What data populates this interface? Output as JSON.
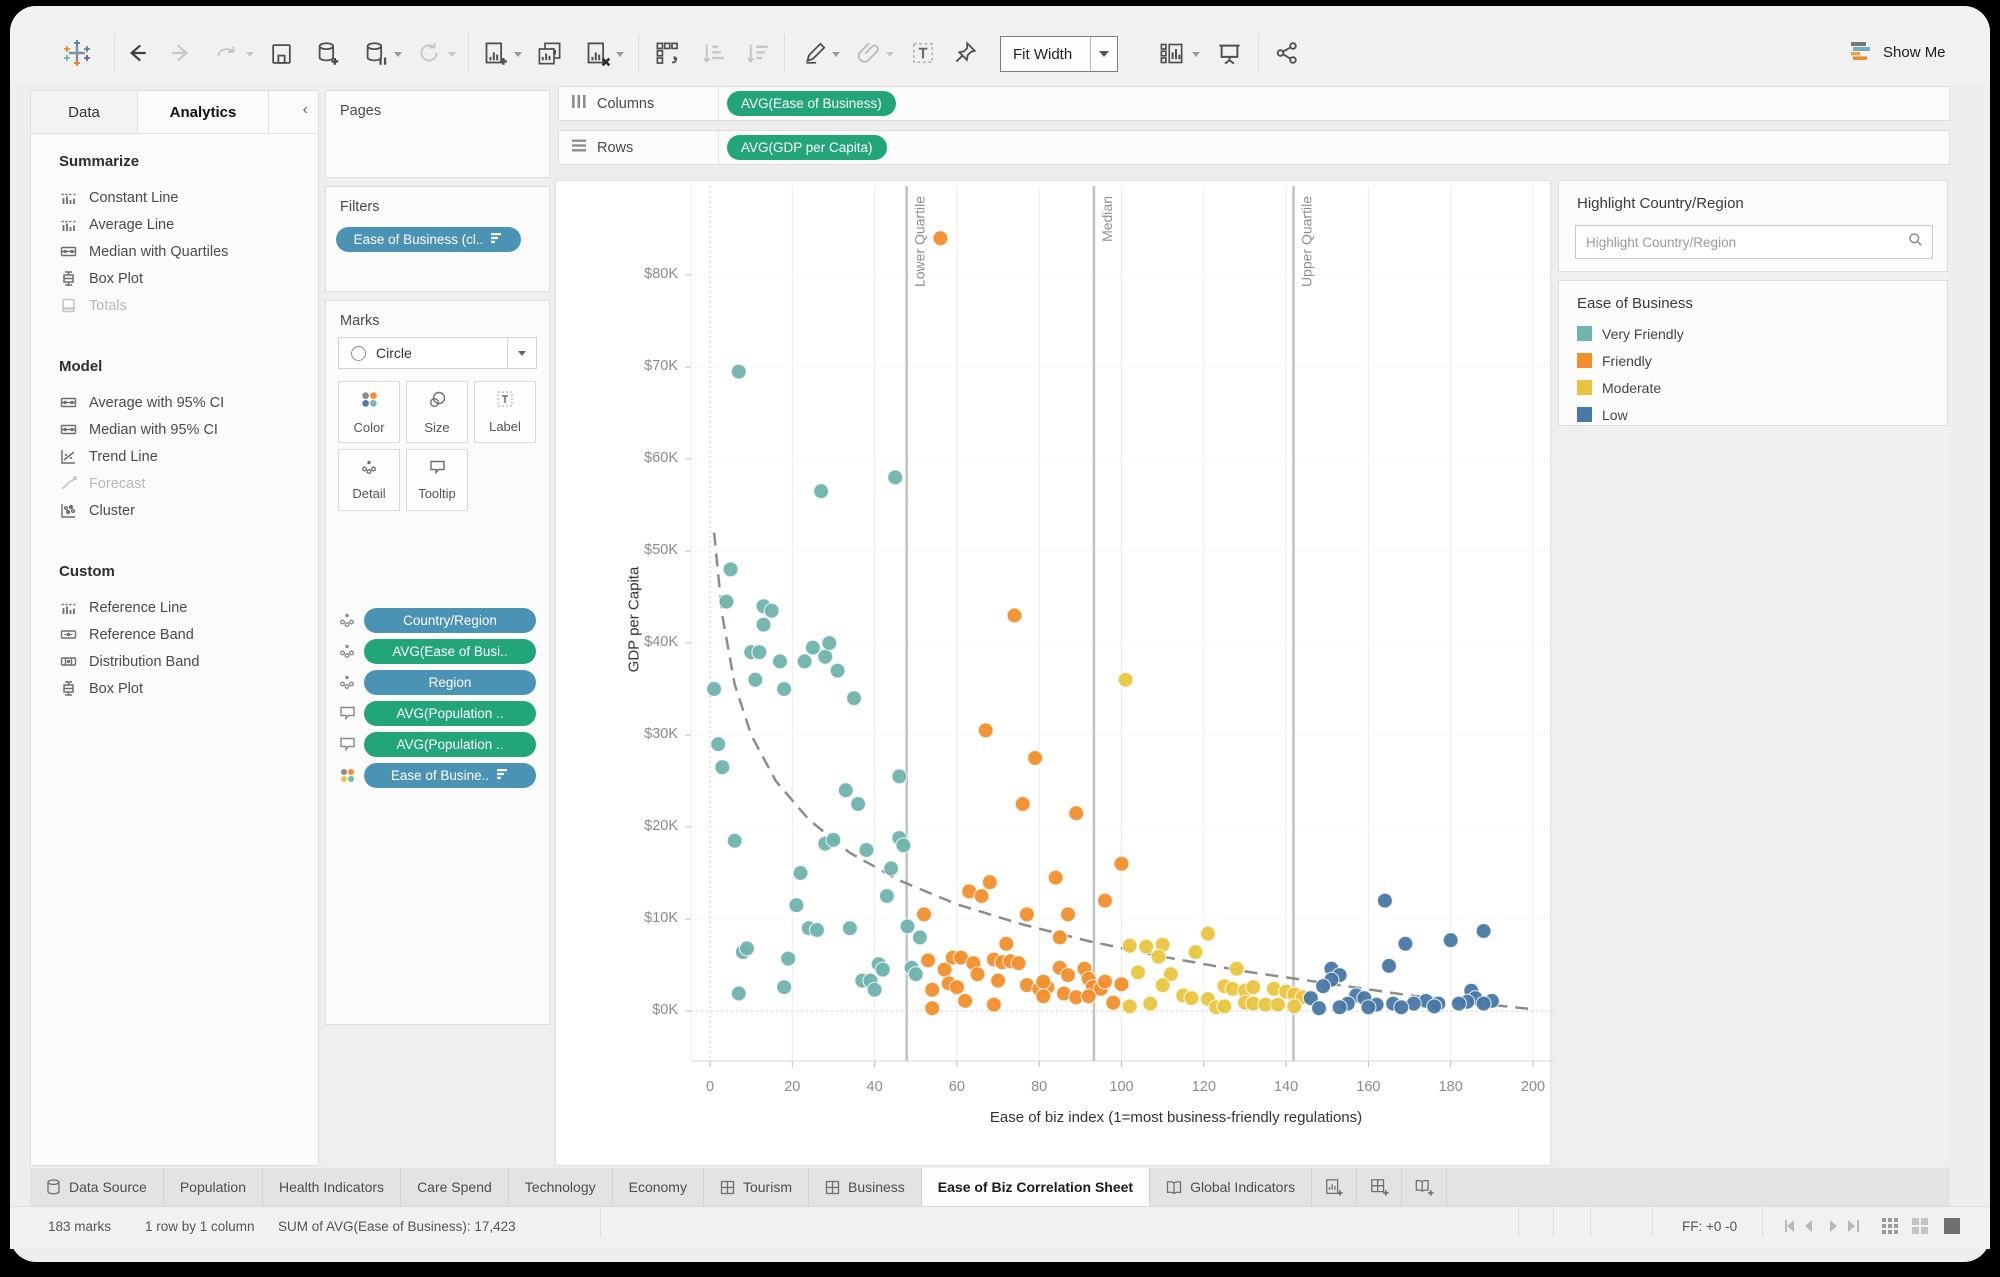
{
  "toolbar": {
    "fit_label": "Fit Width",
    "show_me_label": "Show Me",
    "icons": [
      "tableau-logo",
      "undo",
      "redo",
      "replay",
      "save",
      "add-data-source",
      "pause-auto-updates",
      "run-update",
      "new-worksheet",
      "duplicate-sheet",
      "clear-sheet",
      "swap-rows-columns",
      "sort-ascending",
      "sort-descending",
      "highlight",
      "group-members",
      "show-mark-labels",
      "fix-axes",
      "fit-selector",
      "show-me-toolbar",
      "presentation-mode",
      "share-workbook"
    ]
  },
  "left_panel": {
    "tabs": [
      {
        "label": "Data"
      },
      {
        "label": "Analytics",
        "active": true
      }
    ],
    "collapse_glyph": "‹",
    "sections": [
      {
        "title": "Summarize",
        "items": [
          {
            "label": "Constant Line",
            "icon": "ref-line"
          },
          {
            "label": "Average Line",
            "icon": "ref-line"
          },
          {
            "label": "Median with Quartiles",
            "icon": "band"
          },
          {
            "label": "Box Plot",
            "icon": "boxplot"
          },
          {
            "label": "Totals",
            "icon": "totals",
            "disabled": true
          }
        ]
      },
      {
        "title": "Model",
        "items": [
          {
            "label": "Average with 95% CI",
            "icon": "band"
          },
          {
            "label": "Median with 95% CI",
            "icon": "band"
          },
          {
            "label": "Trend Line",
            "icon": "trend"
          },
          {
            "label": "Forecast",
            "icon": "forecast",
            "disabled": true
          },
          {
            "label": "Cluster",
            "icon": "cluster"
          }
        ]
      },
      {
        "title": "Custom",
        "items": [
          {
            "label": "Reference Line",
            "icon": "ref-line"
          },
          {
            "label": "Reference Band",
            "icon": "ref-band"
          },
          {
            "label": "Distribution Band",
            "icon": "dist-band"
          },
          {
            "label": "Box Plot",
            "icon": "boxplot"
          }
        ]
      }
    ]
  },
  "cards": {
    "pages": {
      "title": "Pages"
    },
    "filters": {
      "title": "Filters",
      "pill": {
        "label": "Ease of Business (cl..",
        "color": "blue",
        "trailing_icon": "sorted-bars"
      }
    },
    "marks": {
      "title": "Marks",
      "mark_type": "Circle",
      "buttons": [
        {
          "label": "Color",
          "icon": "color-dots"
        },
        {
          "label": "Size",
          "icon": "size-circles"
        },
        {
          "label": "Label",
          "icon": "label-t"
        },
        {
          "label": "Detail",
          "icon": "detail-dots"
        },
        {
          "label": "Tooltip",
          "icon": "tooltip-bubble"
        }
      ],
      "pills": [
        {
          "lead": "detail-dots",
          "label": "Country/Region",
          "color": "blue"
        },
        {
          "lead": "detail-dots",
          "label": "AVG(Ease of Busi..",
          "color": "green"
        },
        {
          "lead": "detail-dots",
          "label": "Region",
          "color": "blue"
        },
        {
          "lead": "tooltip-bubble",
          "label": "AVG(Population ..",
          "color": "green"
        },
        {
          "lead": "tooltip-bubble",
          "label": "AVG(Population ..",
          "color": "green"
        },
        {
          "lead": "color-dots",
          "label": "Ease of Busine..",
          "color": "blue",
          "trailing_icon": "sorted-bars"
        }
      ]
    }
  },
  "shelves": {
    "columns": {
      "label": "Columns",
      "pill": "AVG(Ease of Business)"
    },
    "rows": {
      "label": "Rows",
      "pill": "AVG(GDP per Capita)"
    }
  },
  "chart_data": {
    "type": "scatter",
    "xlabel": "Ease of biz index (1=most business-friendly regulations)",
    "ylabel": "GDP per Capita",
    "xlim": [
      -5,
      203
    ],
    "ylim": [
      -5500,
      89500
    ],
    "x_ticks": [
      0,
      20,
      40,
      60,
      80,
      100,
      120,
      140,
      160,
      180,
      200
    ],
    "y_ticks": [
      {
        "v": 0,
        "label": "$0K"
      },
      {
        "v": 10000,
        "label": "$10K"
      },
      {
        "v": 20000,
        "label": "$20K"
      },
      {
        "v": 30000,
        "label": "$30K"
      },
      {
        "v": 40000,
        "label": "$40K"
      },
      {
        "v": 50000,
        "label": "$50K"
      },
      {
        "v": 60000,
        "label": "$60K"
      },
      {
        "v": 70000,
        "label": "$70K"
      },
      {
        "v": 80000,
        "label": "$80K"
      }
    ],
    "legend_title": "Ease of Business",
    "legend_position": "right",
    "grid": true,
    "reference_lines": [
      {
        "label": "Lower Quartile",
        "x": 47.8
      },
      {
        "label": "Median",
        "x": 93.3
      },
      {
        "label": "Upper Quartile",
        "x": 141.8
      }
    ],
    "trend_line": {
      "style": "dashed",
      "points": [
        [
          1,
          52000
        ],
        [
          3,
          43000
        ],
        [
          6,
          35500
        ],
        [
          10,
          30000
        ],
        [
          16,
          25000
        ],
        [
          24,
          20800
        ],
        [
          34,
          17200
        ],
        [
          46,
          14200
        ],
        [
          60,
          11600
        ],
        [
          76,
          9400
        ],
        [
          92,
          7600
        ],
        [
          110,
          5900
        ],
        [
          130,
          4300
        ],
        [
          150,
          3000
        ],
        [
          170,
          1700
        ],
        [
          185,
          900
        ],
        [
          200,
          200
        ]
      ]
    },
    "series": [
      {
        "name": "Very Friendly",
        "color": "#6fb3ae",
        "points": [
          [
            7,
            69500
          ],
          [
            27,
            56500
          ],
          [
            45,
            58000
          ],
          [
            5,
            48000
          ],
          [
            4,
            44500
          ],
          [
            13,
            44000
          ],
          [
            15,
            43500
          ],
          [
            13,
            42000
          ],
          [
            10,
            39000
          ],
          [
            12,
            39000
          ],
          [
            17,
            38000
          ],
          [
            23,
            38000
          ],
          [
            25,
            39500
          ],
          [
            28,
            38500
          ],
          [
            29,
            40000
          ],
          [
            31,
            37000
          ],
          [
            11,
            36000
          ],
          [
            18,
            35000
          ],
          [
            1,
            35000
          ],
          [
            35,
            34000
          ],
          [
            2,
            29000
          ],
          [
            3,
            26500
          ],
          [
            46,
            25500
          ],
          [
            33,
            24000
          ],
          [
            36,
            22500
          ],
          [
            6,
            18500
          ],
          [
            28,
            18200
          ],
          [
            30,
            18600
          ],
          [
            46,
            18800
          ],
          [
            47,
            18000
          ],
          [
            38,
            17500
          ],
          [
            44,
            15500
          ],
          [
            22,
            15000
          ],
          [
            43,
            12500
          ],
          [
            21,
            11500
          ],
          [
            24,
            9000
          ],
          [
            26,
            8800
          ],
          [
            34,
            9000
          ],
          [
            48,
            9200
          ],
          [
            51,
            8000
          ],
          [
            8,
            6400
          ],
          [
            9,
            6800
          ],
          [
            19,
            5700
          ],
          [
            41,
            5100
          ],
          [
            42,
            4500
          ],
          [
            37,
            3300
          ],
          [
            39,
            3300
          ],
          [
            40,
            2300
          ],
          [
            49,
            4700
          ],
          [
            50,
            4000
          ],
          [
            7,
            1900
          ],
          [
            18,
            2600
          ]
        ]
      },
      {
        "name": "Friendly",
        "color": "#f28e2b",
        "points": [
          [
            56,
            84000
          ],
          [
            74,
            43000
          ],
          [
            67,
            30500
          ],
          [
            79,
            27500
          ],
          [
            76,
            22500
          ],
          [
            89,
            21500
          ],
          [
            100,
            16000
          ],
          [
            96,
            12000
          ],
          [
            84,
            14500
          ],
          [
            68,
            14000
          ],
          [
            63,
            13000
          ],
          [
            66,
            12500
          ],
          [
            52,
            10500
          ],
          [
            77,
            10500
          ],
          [
            87,
            10500
          ],
          [
            85,
            8000
          ],
          [
            72,
            7300
          ],
          [
            53,
            5500
          ],
          [
            57,
            4500
          ],
          [
            59,
            5800
          ],
          [
            61,
            5800
          ],
          [
            64,
            5200
          ],
          [
            69,
            5600
          ],
          [
            71,
            5300
          ],
          [
            73,
            5400
          ],
          [
            75,
            5200
          ],
          [
            85,
            4700
          ],
          [
            87,
            3900
          ],
          [
            91,
            4600
          ],
          [
            92,
            3500
          ],
          [
            58,
            3000
          ],
          [
            60,
            2600
          ],
          [
            54,
            2300
          ],
          [
            65,
            4000
          ],
          [
            70,
            3300
          ],
          [
            77,
            2800
          ],
          [
            80,
            2400
          ],
          [
            82,
            2600
          ],
          [
            81,
            3200
          ],
          [
            93,
            2600
          ],
          [
            95,
            2400
          ],
          [
            96,
            3200
          ],
          [
            86,
            1900
          ],
          [
            81,
            1600
          ],
          [
            89,
            1500
          ],
          [
            92,
            1600
          ],
          [
            62,
            1100
          ],
          [
            69,
            700
          ],
          [
            98,
            900
          ],
          [
            54,
            300
          ],
          [
            100,
            2900
          ]
        ]
      },
      {
        "name": "Moderate",
        "color": "#e9c53f",
        "points": [
          [
            101,
            36000
          ],
          [
            121,
            8400
          ],
          [
            102,
            7100
          ],
          [
            106,
            7000
          ],
          [
            110,
            7200
          ],
          [
            109,
            5900
          ],
          [
            118,
            6400
          ],
          [
            104,
            4200
          ],
          [
            112,
            4000
          ],
          [
            128,
            4600
          ],
          [
            110,
            2800
          ],
          [
            125,
            2700
          ],
          [
            127,
            2400
          ],
          [
            130,
            2200
          ],
          [
            132,
            2600
          ],
          [
            137,
            2400
          ],
          [
            140,
            2100
          ],
          [
            142,
            1800
          ],
          [
            115,
            1700
          ],
          [
            117,
            1400
          ],
          [
            144,
            1500
          ],
          [
            121,
            1300
          ],
          [
            130,
            900
          ],
          [
            132,
            800
          ],
          [
            107,
            800
          ],
          [
            135,
            700
          ],
          [
            138,
            700
          ],
          [
            102,
            500
          ],
          [
            123,
            400
          ],
          [
            125,
            500
          ],
          [
            142,
            500
          ]
        ]
      },
      {
        "name": "Low",
        "color": "#4878a4",
        "points": [
          [
            164,
            12000
          ],
          [
            188,
            8700
          ],
          [
            180,
            7700
          ],
          [
            169,
            7300
          ],
          [
            165,
            4900
          ],
          [
            151,
            4600
          ],
          [
            153,
            3900
          ],
          [
            151,
            3400
          ],
          [
            149,
            2700
          ],
          [
            185,
            2200
          ],
          [
            157,
            1700
          ],
          [
            146,
            1400
          ],
          [
            159,
            1400
          ],
          [
            186,
            1400
          ],
          [
            174,
            1100
          ],
          [
            184,
            1000
          ],
          [
            190,
            1100
          ],
          [
            155,
            800
          ],
          [
            162,
            700
          ],
          [
            166,
            800
          ],
          [
            171,
            800
          ],
          [
            177,
            800
          ],
          [
            182,
            800
          ],
          [
            188,
            800
          ],
          [
            148,
            300
          ],
          [
            153,
            400
          ],
          [
            160,
            400
          ],
          [
            168,
            400
          ],
          [
            176,
            500
          ]
        ]
      }
    ]
  },
  "right_panel": {
    "highlight": {
      "title": "Highlight Country/Region",
      "placeholder": "Highlight Country/Region"
    },
    "legend": {
      "title": "Ease of Business",
      "items": [
        {
          "label": "Very Friendly",
          "color": "#6fb3ae"
        },
        {
          "label": "Friendly",
          "color": "#f28e2b"
        },
        {
          "label": "Moderate",
          "color": "#e9c53f"
        },
        {
          "label": "Low",
          "color": "#4878a4"
        }
      ]
    }
  },
  "sheet_tabs": {
    "tabs": [
      {
        "label": "Data Source",
        "icon": "cylinder"
      },
      {
        "label": "Population"
      },
      {
        "label": "Health Indicators"
      },
      {
        "label": "Care Spend"
      },
      {
        "label": "Technology"
      },
      {
        "label": "Economy"
      },
      {
        "label": "Tourism",
        "icon": "grid"
      },
      {
        "label": "Business",
        "icon": "grid"
      },
      {
        "label": "Ease of Biz Correlation Sheet",
        "active": true
      },
      {
        "label": "Global Indicators",
        "icon": "book"
      }
    ],
    "new_buttons": [
      {
        "name": "new-worksheet",
        "icon": "page-plus"
      },
      {
        "name": "new-dashboard",
        "icon": "grid-plus"
      },
      {
        "name": "new-story",
        "icon": "book-plus"
      }
    ]
  },
  "status_bar": {
    "marks_count": "183 marks",
    "layout": "1 row by 1 column",
    "aggregate": "SUM of AVG(Ease of Business): 17,423",
    "ff": "FF: +0 -0"
  }
}
